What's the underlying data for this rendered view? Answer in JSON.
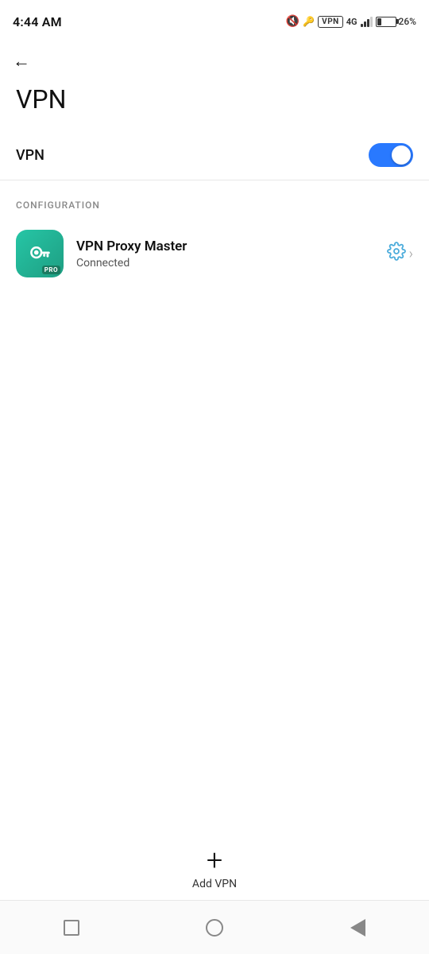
{
  "statusBar": {
    "time": "4:44 AM",
    "vpnBadge": "VPN",
    "signal4g": "4G",
    "batteryPercent": "26%"
  },
  "back": {
    "arrow": "←"
  },
  "page": {
    "title": "VPN"
  },
  "vpnToggle": {
    "label": "VPN",
    "enabled": true
  },
  "configuration": {
    "sectionLabel": "CONFIGURATION",
    "app": {
      "name": "VPN Proxy Master",
      "status": "Connected",
      "proBadge": "PRO"
    }
  },
  "addVpn": {
    "plus": "+",
    "label": "Add VPN"
  },
  "bottomNav": {
    "square": "square",
    "circle": "circle",
    "triangle": "triangle"
  }
}
